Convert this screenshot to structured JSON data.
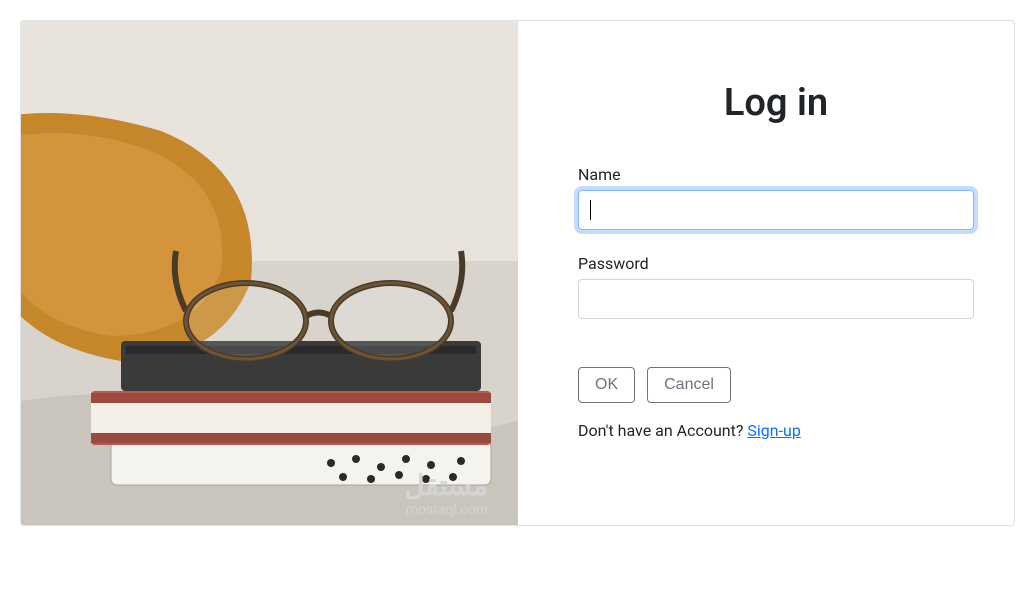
{
  "form": {
    "title": "Log in",
    "name_label": "Name",
    "name_value": "",
    "password_label": "Password",
    "password_value": "",
    "ok_label": "OK",
    "cancel_label": "Cancel",
    "signup_prompt": "Don't have an Account? ",
    "signup_link": "Sign-up"
  },
  "watermark": {
    "arabic": "مستقل",
    "latin": "mostaql.com"
  }
}
